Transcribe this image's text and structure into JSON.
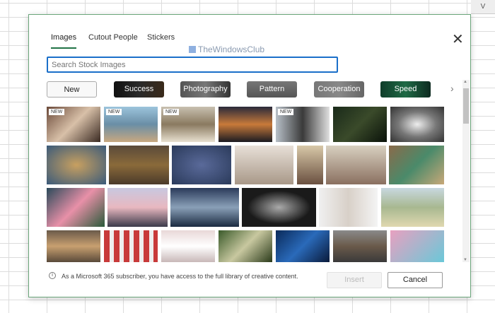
{
  "sheet": {
    "column": "V"
  },
  "tabs": [
    {
      "label": "Images",
      "active": true
    },
    {
      "label": "Cutout People"
    },
    {
      "label": "Stickers"
    }
  ],
  "watermark": "TheWindowsClub",
  "search": {
    "placeholder": "Search Stock Images",
    "value": ""
  },
  "categories": [
    {
      "label": "New",
      "selected": true
    },
    {
      "label": "Success"
    },
    {
      "label": "Photography"
    },
    {
      "label": "Pattern"
    },
    {
      "label": "Cooperation"
    },
    {
      "label": "Speed"
    }
  ],
  "badge_new": "NEW",
  "footer": {
    "info": "As a Microsoft 365 subscriber, you have access to the full library of creative content.",
    "insert": "Insert",
    "cancel": "Cancel"
  },
  "icons": {
    "close": "close-icon",
    "info": "info-icon",
    "next": "chevron-right-icon"
  }
}
